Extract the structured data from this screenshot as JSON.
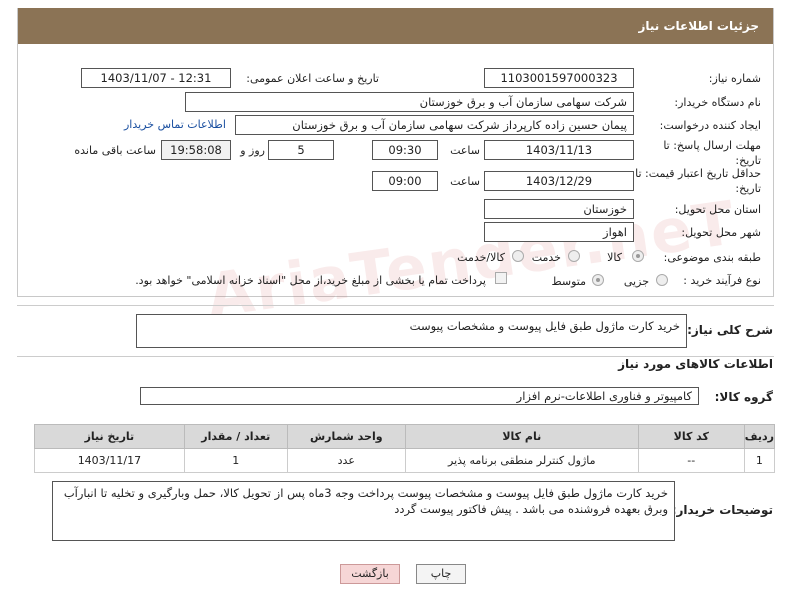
{
  "header": {
    "title": "جزئیات اطلاعات نیاز"
  },
  "fields": {
    "need_number_label": "شماره نیاز:",
    "need_number": "1103001597000323",
    "announce_label": "تاریخ و ساعت اعلان عمومی:",
    "announce_value": "1403/11/07 - 12:31",
    "buyer_org_label": "نام دستگاه خریدار:",
    "buyer_org": "شرکت سهامی سازمان آب و برق خوزستان",
    "creator_label": "ایجاد کننده درخواست:",
    "creator": "پیمان حسین زاده کارپرداز شرکت سهامی سازمان آب و برق خوزستان",
    "contact_link": "اطلاعات تماس خریدار",
    "deadline_label": "مهلت ارسال پاسخ: تا تاریخ:",
    "deadline_date": "1403/11/13",
    "time_label": "ساعت",
    "deadline_time": "09:30",
    "days_value": "5",
    "days_label": "روز و",
    "remaining_time": "19:58:08",
    "remaining_label": "ساعت باقی مانده",
    "validity_label": "حداقل تاریخ اعتبار قیمت: تا تاریخ:",
    "validity_date": "1403/12/29",
    "validity_time_label": "ساعت",
    "validity_time": "09:00",
    "province_label": "استان محل تحویل:",
    "province": "خوزستان",
    "city_label": "شهر محل تحویل:",
    "city": "اهواز",
    "category_label": "طبقه بندی موضوعی:",
    "category_options": [
      "کالا",
      "خدمت",
      "کالا/خدمت"
    ],
    "process_label": "نوع فرآیند خرید :",
    "process_options": [
      "جزیی",
      "متوسط"
    ],
    "payment_note": "پرداخت تمام یا بخشی از مبلغ خرید،از محل \"اسناد خزانه اسلامی\" خواهد بود."
  },
  "description": {
    "label": "شرح کلی نیاز:",
    "value": "خرید کارت ماژول طبق فایل پیوست و مشخصات پیوست"
  },
  "goods_section": {
    "title": "اطلاعات کالاهای مورد نیاز",
    "group_label": "گروه کالا:",
    "group_value": "کامپیوتر و فناوری اطلاعات-نرم افزار"
  },
  "table": {
    "headers": [
      "ردیف",
      "کد کالا",
      "نام کالا",
      "واحد شمارش",
      "تعداد / مقدار",
      "تاریخ نیاز"
    ],
    "rows": [
      [
        "1",
        "--",
        "ماژول کنترلر منطقی برنامه پذیر",
        "عدد",
        "1",
        "1403/11/17"
      ]
    ]
  },
  "buyer_notes": {
    "label": "توضیحات خریدار:",
    "value": "خرید کارت ماژول طبق فایل پیوست و مشخصات پیوست پرداخت وجه 3ماه پس از تحویل کالا، حمل وبارگیری و تخلیه تا انبارآب وبرق بعهده فروشنده می باشد . پیش فاکتور پیوست گردد"
  },
  "buttons": {
    "print": "چاپ",
    "back": "بازگشت"
  },
  "watermark": "AriaTender.neT",
  "colors": {
    "header_bg": "#8b7355",
    "back_button_bg": "#f6d6d6"
  }
}
